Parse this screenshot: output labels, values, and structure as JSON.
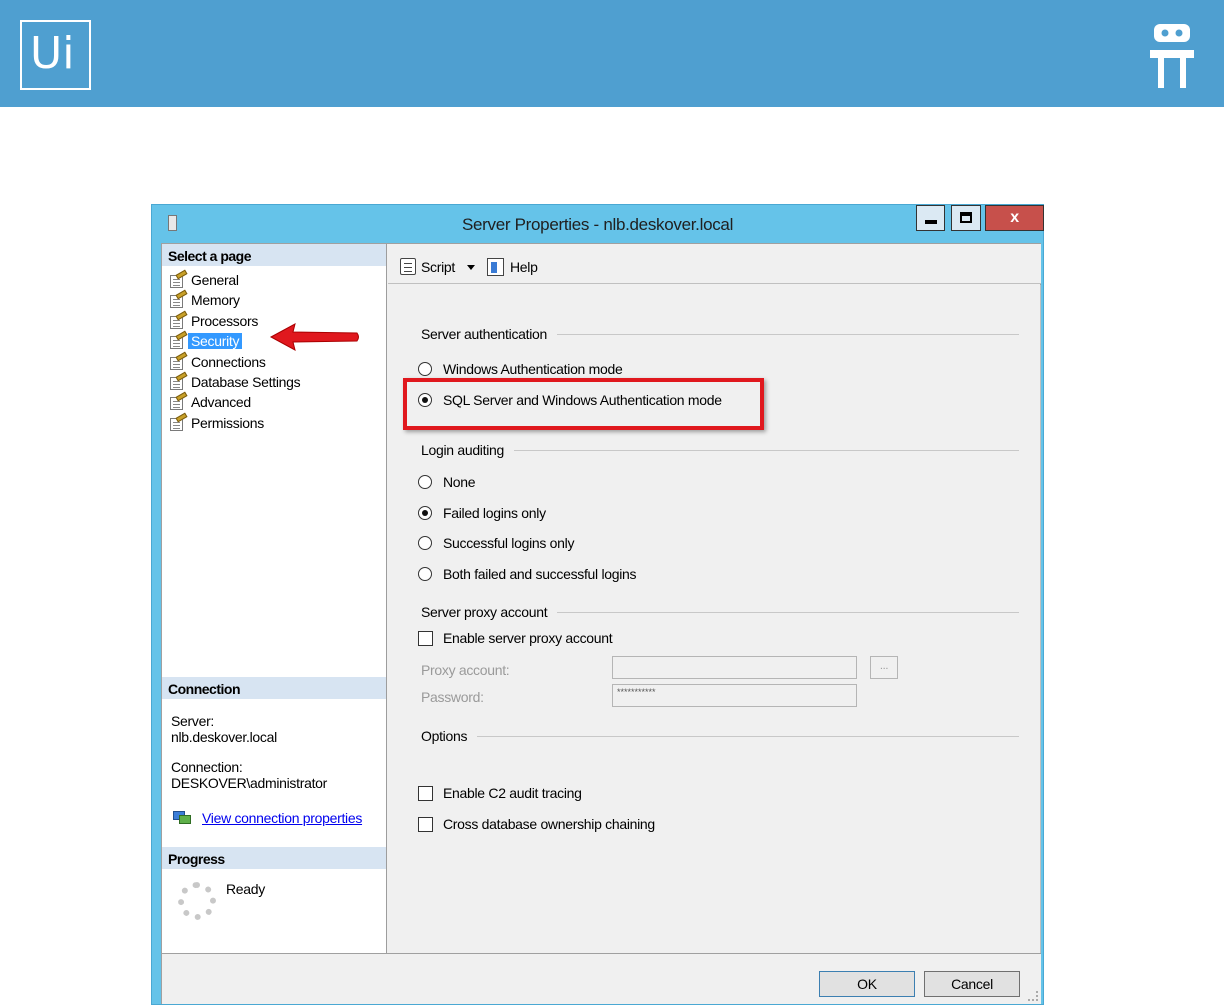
{
  "banner": {
    "logo_text": "Ui",
    "bg_color": "#4f9fd0",
    "robot_icon": "robot-icon"
  },
  "window": {
    "title": "Server Properties - nlb.deskover.local",
    "controls": {
      "minimize": "minimize",
      "maximize": "maximize",
      "close": "x"
    }
  },
  "sidebar": {
    "header": "Select a page",
    "items": [
      {
        "label": "General"
      },
      {
        "label": "Memory"
      },
      {
        "label": "Processors"
      },
      {
        "label": "Security",
        "selected": true
      },
      {
        "label": "Connections"
      },
      {
        "label": "Database Settings"
      },
      {
        "label": "Advanced"
      },
      {
        "label": "Permissions"
      }
    ],
    "connection": {
      "header": "Connection",
      "server_label": "Server:",
      "server_value": "nlb.deskover.local",
      "connection_label": "Connection:",
      "connection_value": "DESKOVER\\administrator",
      "link": "View connection properties"
    },
    "progress": {
      "header": "Progress",
      "status": "Ready"
    }
  },
  "toolbar": {
    "script_label": "Script",
    "help_label": "Help"
  },
  "security": {
    "server_auth": {
      "title": "Server authentication",
      "options": [
        {
          "label": "Windows Authentication mode",
          "checked": false
        },
        {
          "label": "SQL Server and Windows Authentication mode",
          "checked": true
        }
      ]
    },
    "login_auditing": {
      "title": "Login auditing",
      "options": [
        {
          "label": "None",
          "checked": false
        },
        {
          "label": "Failed logins only",
          "checked": true
        },
        {
          "label": "Successful logins only",
          "checked": false
        },
        {
          "label": "Both failed and successful logins",
          "checked": false
        }
      ]
    },
    "proxy": {
      "title": "Server proxy account",
      "enable_label": "Enable server proxy account",
      "enabled": false,
      "account_label": "Proxy account:",
      "account_value": "",
      "browse_label": "...",
      "password_label": "Password:",
      "password_value": "***********"
    },
    "options": {
      "title": "Options",
      "items": [
        {
          "label": "Enable C2 audit tracing",
          "checked": false
        },
        {
          "label": "Cross database ownership chaining",
          "checked": false
        }
      ]
    }
  },
  "footer": {
    "ok_label": "OK",
    "cancel_label": "Cancel"
  },
  "annotation": {
    "highlight_color": "#e0181e",
    "arrow_color": "#e0181e"
  }
}
